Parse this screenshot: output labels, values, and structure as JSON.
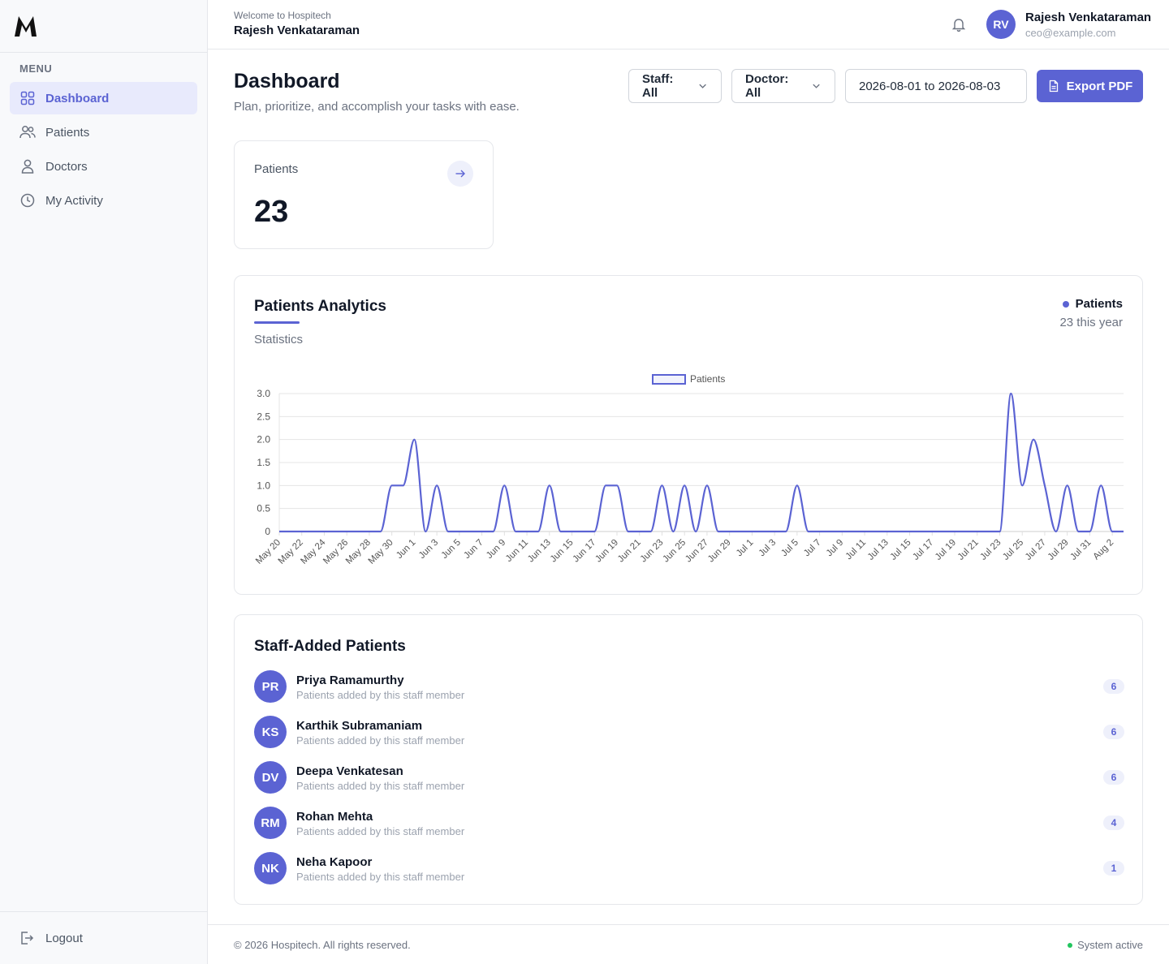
{
  "sidebar": {
    "logo_text": "M",
    "menu_title": "MENU",
    "items": [
      {
        "label": "Dashboard",
        "icon": "grid-icon",
        "active": true
      },
      {
        "label": "Patients",
        "icon": "users-icon",
        "active": false
      },
      {
        "label": "Doctors",
        "icon": "user-icon",
        "active": false
      },
      {
        "label": "My Activity",
        "icon": "clock-icon",
        "active": false
      }
    ],
    "logout_label": "Logout"
  },
  "topbar": {
    "welcome": "Welcome to Hospitech",
    "user_name": "Rajesh Venkataraman",
    "avatar_initials": "RV",
    "profile_name": "Rajesh Venkataraman",
    "profile_email": "ceo@example.com"
  },
  "page": {
    "title": "Dashboard",
    "subtitle": "Plan, prioritize, and accomplish your tasks with ease."
  },
  "filters": {
    "staff": "Staff: All",
    "doctor": "Doctor: All",
    "date_range": "2026-08-01 to 2026-08-03",
    "export_label": "Export PDF"
  },
  "stat_card": {
    "label": "Patients",
    "value": "23"
  },
  "analytics": {
    "title": "Patients Analytics",
    "subtitle": "Statistics",
    "legend_label": "Patients",
    "legend_sub": "23 this year"
  },
  "chart_data": {
    "type": "line",
    "legend": "Patients",
    "ylim": [
      0,
      3
    ],
    "y_ticks": [
      "3.0",
      "2.5",
      "2.0",
      "1.5",
      "1.0",
      "0.5",
      "0"
    ],
    "x_tick_labels": [
      "May 20",
      "May 22",
      "May 24",
      "May 26",
      "May 28",
      "May 30",
      "Jun 1",
      "Jun 3",
      "Jun 5",
      "Jun 7",
      "Jun 9",
      "Jun 11",
      "Jun 13",
      "Jun 15",
      "Jun 17",
      "Jun 19",
      "Jun 21",
      "Jun 23",
      "Jun 25",
      "Jun 27",
      "Jun 29",
      "Jul 1",
      "Jul 3",
      "Jul 5",
      "Jul 7",
      "Jul 9",
      "Jul 11",
      "Jul 13",
      "Jul 15",
      "Jul 17",
      "Jul 19",
      "Jul 21",
      "Jul 23",
      "Jul 25",
      "Jul 27",
      "Jul 29",
      "Jul 31",
      "Aug 2"
    ],
    "x": [
      "May 20",
      "May 21",
      "May 22",
      "May 23",
      "May 24",
      "May 25",
      "May 26",
      "May 27",
      "May 28",
      "May 29",
      "May 30",
      "May 31",
      "Jun 1",
      "Jun 2",
      "Jun 3",
      "Jun 4",
      "Jun 5",
      "Jun 6",
      "Jun 7",
      "Jun 8",
      "Jun 9",
      "Jun 10",
      "Jun 11",
      "Jun 12",
      "Jun 13",
      "Jun 14",
      "Jun 15",
      "Jun 16",
      "Jun 17",
      "Jun 18",
      "Jun 19",
      "Jun 20",
      "Jun 21",
      "Jun 22",
      "Jun 23",
      "Jun 24",
      "Jun 25",
      "Jun 26",
      "Jun 27",
      "Jun 28",
      "Jun 29",
      "Jun 30",
      "Jul 1",
      "Jul 2",
      "Jul 3",
      "Jul 4",
      "Jul 5",
      "Jul 6",
      "Jul 7",
      "Jul 8",
      "Jul 9",
      "Jul 10",
      "Jul 11",
      "Jul 12",
      "Jul 13",
      "Jul 14",
      "Jul 15",
      "Jul 16",
      "Jul 17",
      "Jul 18",
      "Jul 19",
      "Jul 20",
      "Jul 21",
      "Jul 22",
      "Jul 23",
      "Jul 24",
      "Jul 25",
      "Jul 26",
      "Jul 27",
      "Jul 28",
      "Jul 29",
      "Jul 30",
      "Jul 31",
      "Aug 1",
      "Aug 2",
      "Aug 3"
    ],
    "series": [
      {
        "name": "Patients",
        "values": [
          0,
          0,
          0,
          0,
          0,
          0,
          0,
          0,
          0,
          0,
          1,
          1,
          2,
          0,
          1,
          0,
          0,
          0,
          0,
          0,
          1,
          0,
          0,
          0,
          1,
          0,
          0,
          0,
          0,
          1,
          1,
          0,
          0,
          0,
          1,
          0,
          1,
          0,
          1,
          0,
          0,
          0,
          0,
          0,
          0,
          0,
          1,
          0,
          0,
          0,
          0,
          0,
          0,
          0,
          0,
          0,
          0,
          0,
          0,
          0,
          0,
          0,
          0,
          0,
          0,
          3,
          1,
          2,
          1,
          0,
          1,
          0,
          0,
          1,
          0,
          0
        ]
      }
    ],
    "color": "#5b63d3"
  },
  "staff_section": {
    "title": "Staff-Added Patients",
    "rows": [
      {
        "initials": "PR",
        "name": "Priya Ramamurthy",
        "desc": "Patients added by this staff member",
        "count": "6"
      },
      {
        "initials": "KS",
        "name": "Karthik Subramaniam",
        "desc": "Patients added by this staff member",
        "count": "6"
      },
      {
        "initials": "DV",
        "name": "Deepa Venkatesan",
        "desc": "Patients added by this staff member",
        "count": "6"
      },
      {
        "initials": "RM",
        "name": "Rohan Mehta",
        "desc": "Patients added by this staff member",
        "count": "4"
      },
      {
        "initials": "NK",
        "name": "Neha Kapoor",
        "desc": "Patients added by this staff member",
        "count": "1"
      }
    ]
  },
  "footer": {
    "copyright": "© 2026 Hospitech. All rights reserved.",
    "status": "System active"
  }
}
